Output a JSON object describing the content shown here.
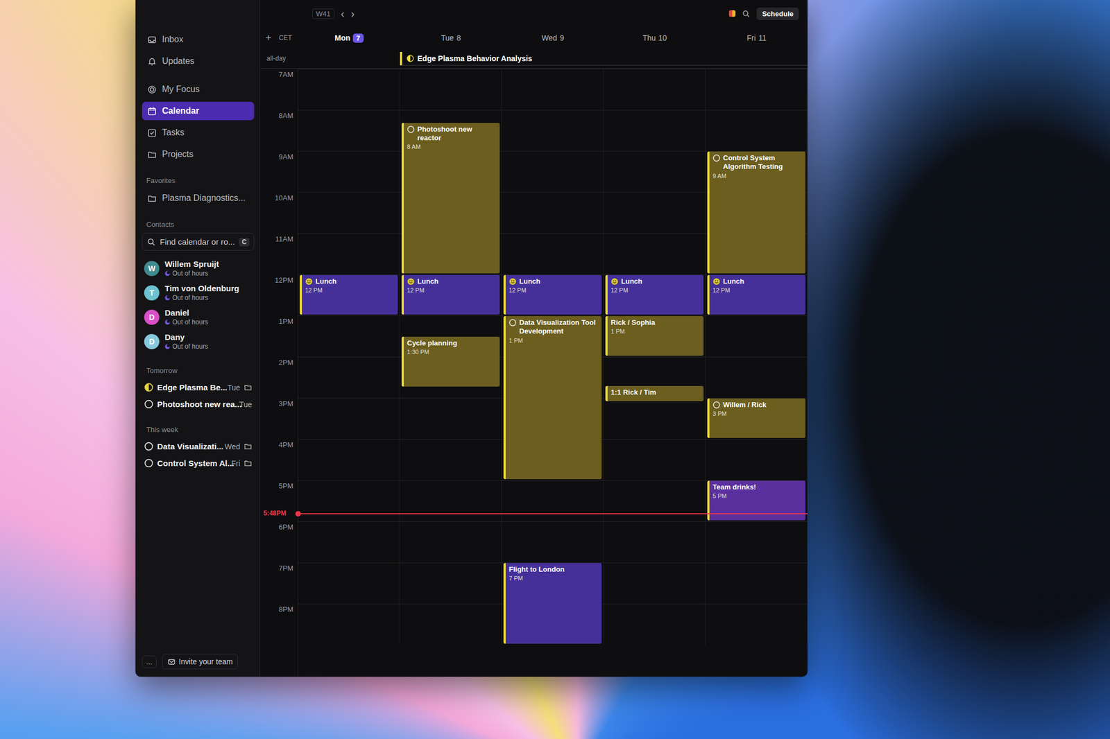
{
  "toolbar": {
    "week": "W41",
    "prev": "‹",
    "next": "›",
    "schedule": "Schedule"
  },
  "sidebar": {
    "items": [
      {
        "label": "Inbox",
        "selected": false
      },
      {
        "label": "Updates",
        "selected": false
      },
      {
        "label": "My Focus",
        "selected": false
      },
      {
        "label": "Calendar",
        "selected": true
      },
      {
        "label": "Tasks",
        "selected": false
      },
      {
        "label": "Projects",
        "selected": false
      }
    ],
    "favorites_heading": "Favorites",
    "favorites": [
      {
        "label": "Plasma Diagnostics..."
      }
    ],
    "contacts_heading": "Contacts",
    "search": {
      "placeholder": "Find calendar or ro...",
      "shortcut": "C"
    },
    "contacts": [
      {
        "initial": "W",
        "name": "Willem Spruijt",
        "status": "Out of hours",
        "color": "#3f8a8f"
      },
      {
        "initial": "T",
        "name": "Tim von Oldenburg",
        "status": "Out of hours",
        "color": "#6cc3cf"
      },
      {
        "initial": "D",
        "name": "Daniel",
        "status": "Out of hours",
        "color": "#d94fc8"
      },
      {
        "initial": "D",
        "name": "Dany",
        "status": "Out of hours",
        "color": "#86c9dc"
      }
    ],
    "tomorrow_heading": "Tomorrow",
    "tomorrow": [
      {
        "label": "Edge Plasma Be...",
        "day": "Tue",
        "kind": "half",
        "project": true
      },
      {
        "label": "Photoshoot new rea...",
        "day": "Tue",
        "kind": "task",
        "project": false
      }
    ],
    "week_heading": "This week",
    "this_week": [
      {
        "label": "Data Visualizati...",
        "day": "Wed",
        "kind": "task",
        "project": true
      },
      {
        "label": "Control System Al...",
        "day": "Fri",
        "kind": "task",
        "project": true
      }
    ],
    "more": "...",
    "invite": "Invite your team"
  },
  "calendar": {
    "add": "+",
    "timezone": "CET",
    "allday_label": "all-day",
    "now": "5:48PM",
    "hours": [
      "7AM",
      "8AM",
      "9AM",
      "10AM",
      "11AM",
      "12PM",
      "1PM",
      "2PM",
      "3PM",
      "4PM",
      "5PM",
      "6PM",
      "7PM",
      "8PM"
    ],
    "all_day_events": [
      {
        "title": "Edge Plasma Behavior Analysis",
        "from": 1,
        "to": 4,
        "color": "#e8d63c"
      }
    ],
    "days": [
      {
        "name": "Mon",
        "date": "7",
        "today": true,
        "events": [
          {
            "title": "Lunch",
            "time": "12 PM",
            "start": 12,
            "end": 13,
            "kind": "lunch",
            "color": "#45309a"
          }
        ]
      },
      {
        "name": "Tue",
        "date": "8",
        "today": false,
        "events": [
          {
            "title": "Photoshoot new reactor",
            "time": "8 AM",
            "start": 8.3,
            "end": 12,
            "kind": "task",
            "color": "#6b5e1f"
          },
          {
            "title": "Lunch",
            "time": "12 PM",
            "start": 12,
            "end": 13,
            "kind": "lunch",
            "color": "#45309a"
          },
          {
            "title": "Cycle planning",
            "time": "1:30 PM",
            "start": 13.5,
            "end": 14.75,
            "kind": "none",
            "color": "#6b5e1f"
          }
        ]
      },
      {
        "name": "Wed",
        "date": "9",
        "today": false,
        "events": [
          {
            "title": "Lunch",
            "time": "12 PM",
            "start": 12,
            "end": 13,
            "kind": "lunch",
            "color": "#45309a"
          },
          {
            "title": "Data Visualization Tool Development",
            "time": "1 PM",
            "start": 13,
            "end": 17,
            "kind": "task",
            "color": "#6b5e1f"
          },
          {
            "title": "Flight to London",
            "time": "7 PM",
            "start": 19,
            "end": 21,
            "kind": "none",
            "color": "#45309a"
          }
        ]
      },
      {
        "name": "Thu",
        "date": "10",
        "today": false,
        "events": [
          {
            "title": "Lunch",
            "time": "12 PM",
            "start": 12,
            "end": 13,
            "kind": "lunch",
            "color": "#45309a"
          },
          {
            "title": "Rick / Sophia",
            "time": "1 PM",
            "start": 13,
            "end": 14,
            "kind": "none",
            "color": "#6b5e1f"
          },
          {
            "title": "1:1 Rick / Tim",
            "time": "",
            "start": 14.7,
            "end": 15.1,
            "kind": "none",
            "color": "#6b5e1f"
          }
        ]
      },
      {
        "name": "Fri",
        "date": "11",
        "today": false,
        "events": [
          {
            "title": "Control System Algorithm Testing",
            "time": "9 AM",
            "start": 9,
            "end": 12,
            "kind": "task",
            "color": "#6b5e1f"
          },
          {
            "title": "Lunch",
            "time": "12 PM",
            "start": 12,
            "end": 13,
            "kind": "lunch",
            "color": "#45309a"
          },
          {
            "title": "Willem / Rick",
            "time": "3 PM",
            "start": 15,
            "end": 16,
            "kind": "task",
            "color": "#6b5e1f"
          },
          {
            "title": "Team drinks!",
            "time": "5 PM",
            "start": 17,
            "end": 18,
            "kind": "none",
            "color": "#5a2f9e"
          }
        ]
      }
    ]
  }
}
